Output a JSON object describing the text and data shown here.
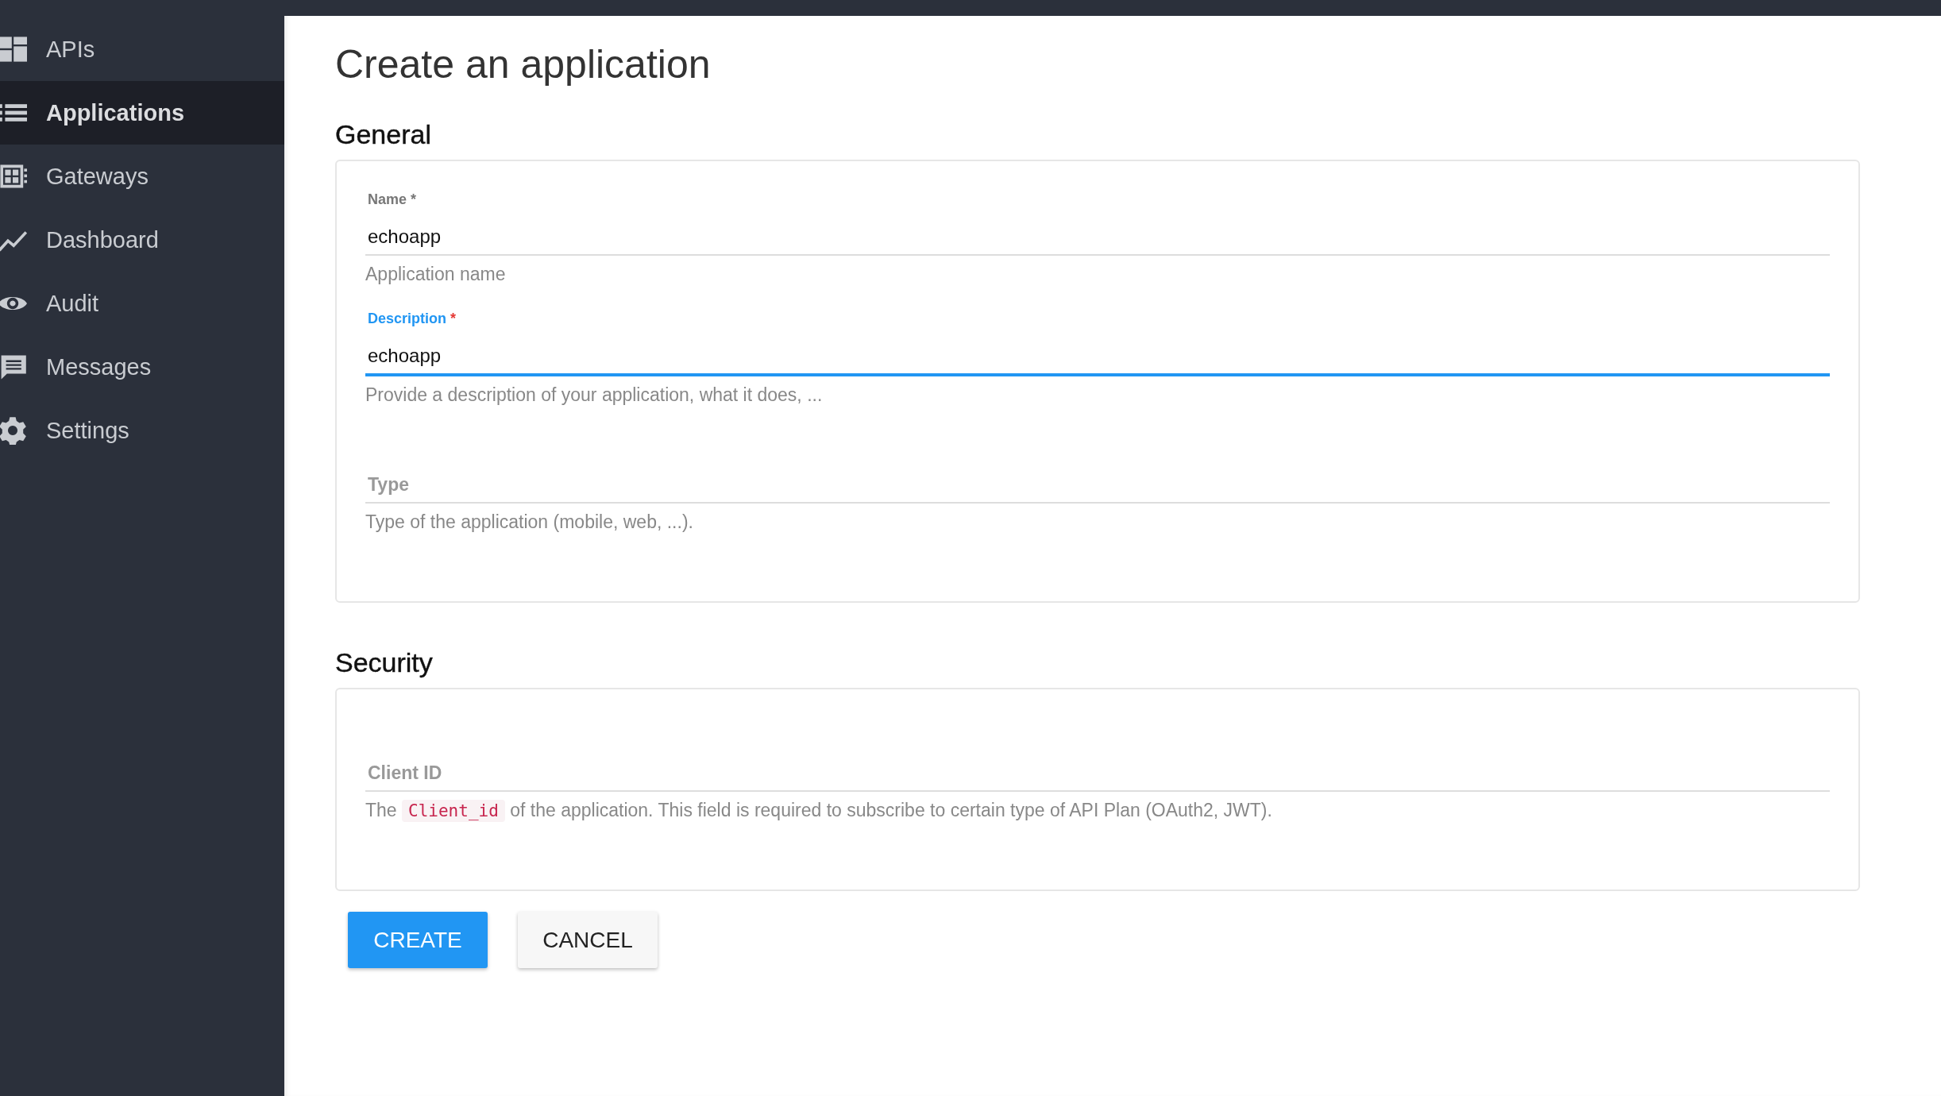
{
  "sidebar": {
    "items": [
      {
        "label": "APIs",
        "selected": false
      },
      {
        "label": "Applications",
        "selected": true
      },
      {
        "label": "Gateways",
        "selected": false
      },
      {
        "label": "Dashboard",
        "selected": false
      },
      {
        "label": "Audit",
        "selected": false
      },
      {
        "label": "Messages",
        "selected": false
      },
      {
        "label": "Settings",
        "selected": false
      }
    ]
  },
  "page": {
    "title": "Create an application"
  },
  "sections": [
    {
      "heading": "General",
      "fields": [
        {
          "label": "Name",
          "required_mark": "*",
          "value": "echoapp",
          "helper": "Application name",
          "focused": false
        },
        {
          "label": "Description",
          "required_mark": "*",
          "value": "echoapp",
          "helper": "Provide a description of your application, what it does, ...",
          "focused": true
        },
        {
          "label": "Type",
          "helper": "Type of the application (mobile, web, ...).",
          "focused": false
        }
      ]
    },
    {
      "heading": "Security",
      "fields": [
        {
          "label": "Client ID",
          "helper_before": "The",
          "helper_code": "Client_id",
          "helper_after": "of the application. This field is required to subscribe to certain type of API Plan (OAuth2, JWT).",
          "focused": false
        }
      ]
    }
  ],
  "buttons": [
    {
      "label": "CREATE",
      "kind": "primary"
    },
    {
      "label": "CANCEL",
      "kind": "secondary"
    }
  ]
}
